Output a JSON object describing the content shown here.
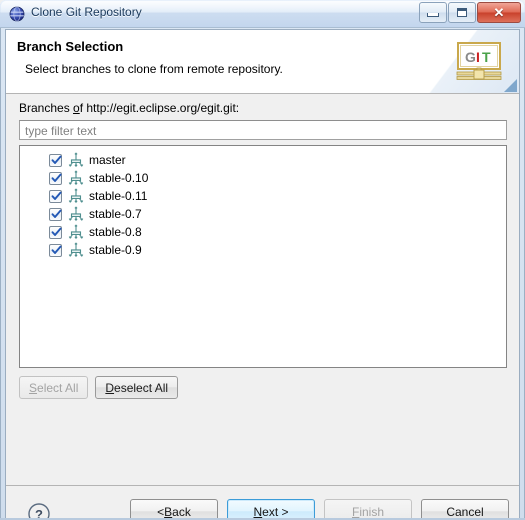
{
  "window": {
    "title": "Clone Git Repository",
    "icon": "eclipse-sphere-icon",
    "controls": {
      "minimize": "minimize-icon",
      "maximize": "maximize-icon",
      "close": "✕"
    }
  },
  "header": {
    "title": "Branch Selection",
    "description": "Select branches to clone from remote repository.",
    "logo": {
      "letters": [
        "G",
        "I",
        "T"
      ],
      "colors": [
        "#8a8a8a",
        "#cc2222",
        "#4aa24a"
      ]
    }
  },
  "body": {
    "branches_label_prefix": "Branches ",
    "branches_label_mnemonic": "o",
    "branches_label_suffix": "f http://egit.eclipse.org/egit.git:",
    "filter": {
      "value": "",
      "placeholder": "type filter text"
    },
    "branches": [
      {
        "label": "master",
        "checked": true,
        "icon": "branch-icon"
      },
      {
        "label": "stable-0.10",
        "checked": true,
        "icon": "branch-icon"
      },
      {
        "label": "stable-0.11",
        "checked": true,
        "icon": "branch-icon"
      },
      {
        "label": "stable-0.7",
        "checked": true,
        "icon": "branch-icon"
      },
      {
        "label": "stable-0.8",
        "checked": true,
        "icon": "branch-icon"
      },
      {
        "label": "stable-0.9",
        "checked": true,
        "icon": "branch-icon"
      }
    ],
    "select_buttons": [
      {
        "prefix": "",
        "mnemonic": "S",
        "suffix": "elect All",
        "enabled": false
      },
      {
        "prefix": "",
        "mnemonic": "D",
        "suffix": "eselect All",
        "enabled": true
      }
    ]
  },
  "footer": {
    "help": "?",
    "buttons": [
      {
        "prefix": "< ",
        "mnemonic": "B",
        "suffix": "ack",
        "enabled": true,
        "default": false
      },
      {
        "prefix": "",
        "mnemonic": "N",
        "suffix": "ext >",
        "enabled": true,
        "default": true
      },
      {
        "prefix": "",
        "mnemonic": "F",
        "suffix": "inish",
        "enabled": false,
        "default": false
      },
      {
        "prefix": "",
        "mnemonic": "",
        "suffix": "Cancel",
        "enabled": true,
        "default": false
      }
    ]
  }
}
